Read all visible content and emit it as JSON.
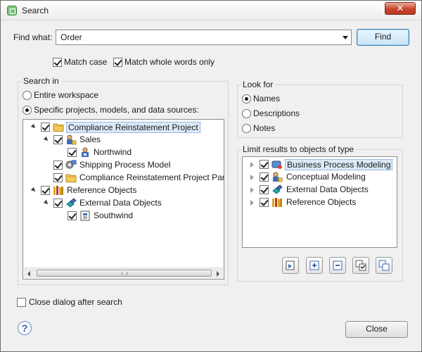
{
  "window": {
    "title": "Search"
  },
  "find": {
    "label": "Find what:",
    "value": "Order",
    "button": "Find"
  },
  "options": {
    "match_case": "Match case",
    "match_whole_words": "Match whole words only"
  },
  "search_in": {
    "label": "Search in",
    "entire_workspace": "Entire workspace",
    "specific": "Specific projects, models, and data sources:",
    "tree": [
      {
        "label": "Compliance Reinstatement Project",
        "icon": "folder-icon"
      },
      {
        "label": "Sales",
        "icon": "people-model-icon"
      },
      {
        "label": "Northwind",
        "icon": "database-diagram-icon"
      },
      {
        "label": "Shipping Process Model",
        "icon": "process-model-icon"
      },
      {
        "label": "Compliance Reinstatement Project Par",
        "icon": "folder-icon"
      },
      {
        "label": "Reference Objects",
        "icon": "books-icon"
      },
      {
        "label": "External Data Objects",
        "icon": "data-objects-icon"
      },
      {
        "label": "Southwind",
        "icon": "database-diagram-icon"
      }
    ]
  },
  "look_for": {
    "label": "Look for",
    "options": [
      "Names",
      "Descriptions",
      "Notes"
    ],
    "selected": "Names"
  },
  "limit": {
    "label": "Limit results to objects of type",
    "items": [
      "Business Process Modeling",
      "Conceptual Modeling",
      "External Data Objects",
      "Reference Objects"
    ]
  },
  "toolbar": [
    "open-item-icon",
    "expand-all-icon",
    "collapse-all-icon",
    "check-all-icon",
    "uncheck-all-icon"
  ],
  "footer": {
    "close_after": "Close dialog after search",
    "close_button": "Close",
    "help": "?"
  }
}
